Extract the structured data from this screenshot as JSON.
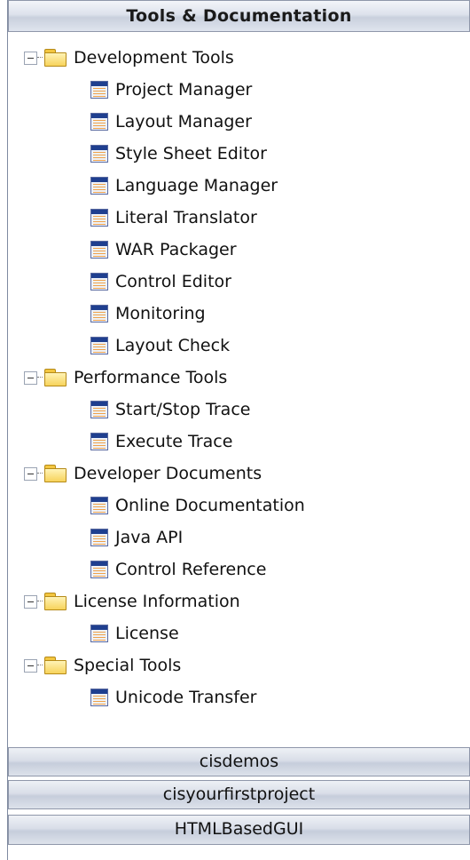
{
  "panel": {
    "title": "Tools & Documentation"
  },
  "tree": {
    "groups": [
      {
        "label": "Development Tools",
        "items": [
          "Project Manager",
          "Layout Manager",
          "Style Sheet Editor",
          "Language Manager",
          "Literal Translator",
          "WAR Packager",
          "Control Editor",
          "Monitoring",
          "Layout Check"
        ]
      },
      {
        "label": "Performance Tools",
        "items": [
          "Start/Stop Trace",
          "Execute Trace"
        ]
      },
      {
        "label": "Developer Documents",
        "items": [
          "Online Documentation",
          "Java API",
          "Control Reference"
        ]
      },
      {
        "label": "License Information",
        "items": [
          "License"
        ]
      },
      {
        "label": "Special Tools",
        "items": [
          "Unicode Transfer"
        ]
      }
    ]
  },
  "sections": [
    "cisdemos",
    "cisyourfirstproject",
    "HTMLBasedGUI"
  ],
  "icons": {
    "folder": "folder-icon",
    "document": "document-icon",
    "collapse": "collapse-icon"
  },
  "colors": {
    "folder_fill": "#f7d35b",
    "doc_header": "#1f3f8f",
    "bar_gradient_mid": "#c6cddb"
  }
}
